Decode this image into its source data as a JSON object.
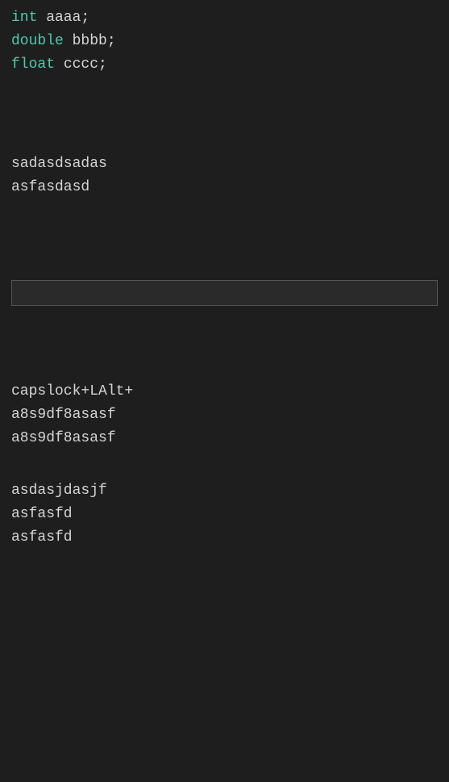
{
  "editor": {
    "lines": [
      {
        "keyword": "int",
        "rest": " aaaa;"
      },
      {
        "keyword": "double",
        "rest": " bbbb;"
      },
      {
        "keyword": "float",
        "rest": " cccc;"
      }
    ],
    "blank1": "",
    "blank2": "",
    "plain_block1": [
      "sadasdsadas",
      "asfasdasd"
    ],
    "blank3": "",
    "blank4": "",
    "input_placeholder": "",
    "blank5": "",
    "blank6": "",
    "plain_block2": [
      "capslock+LAlt+",
      "a8s9df8asasf",
      "a8s9df8asasf"
    ],
    "blank7": "",
    "plain_block3": [
      "asdasjdasjf",
      "asfasfd",
      "asfasfd"
    ]
  }
}
